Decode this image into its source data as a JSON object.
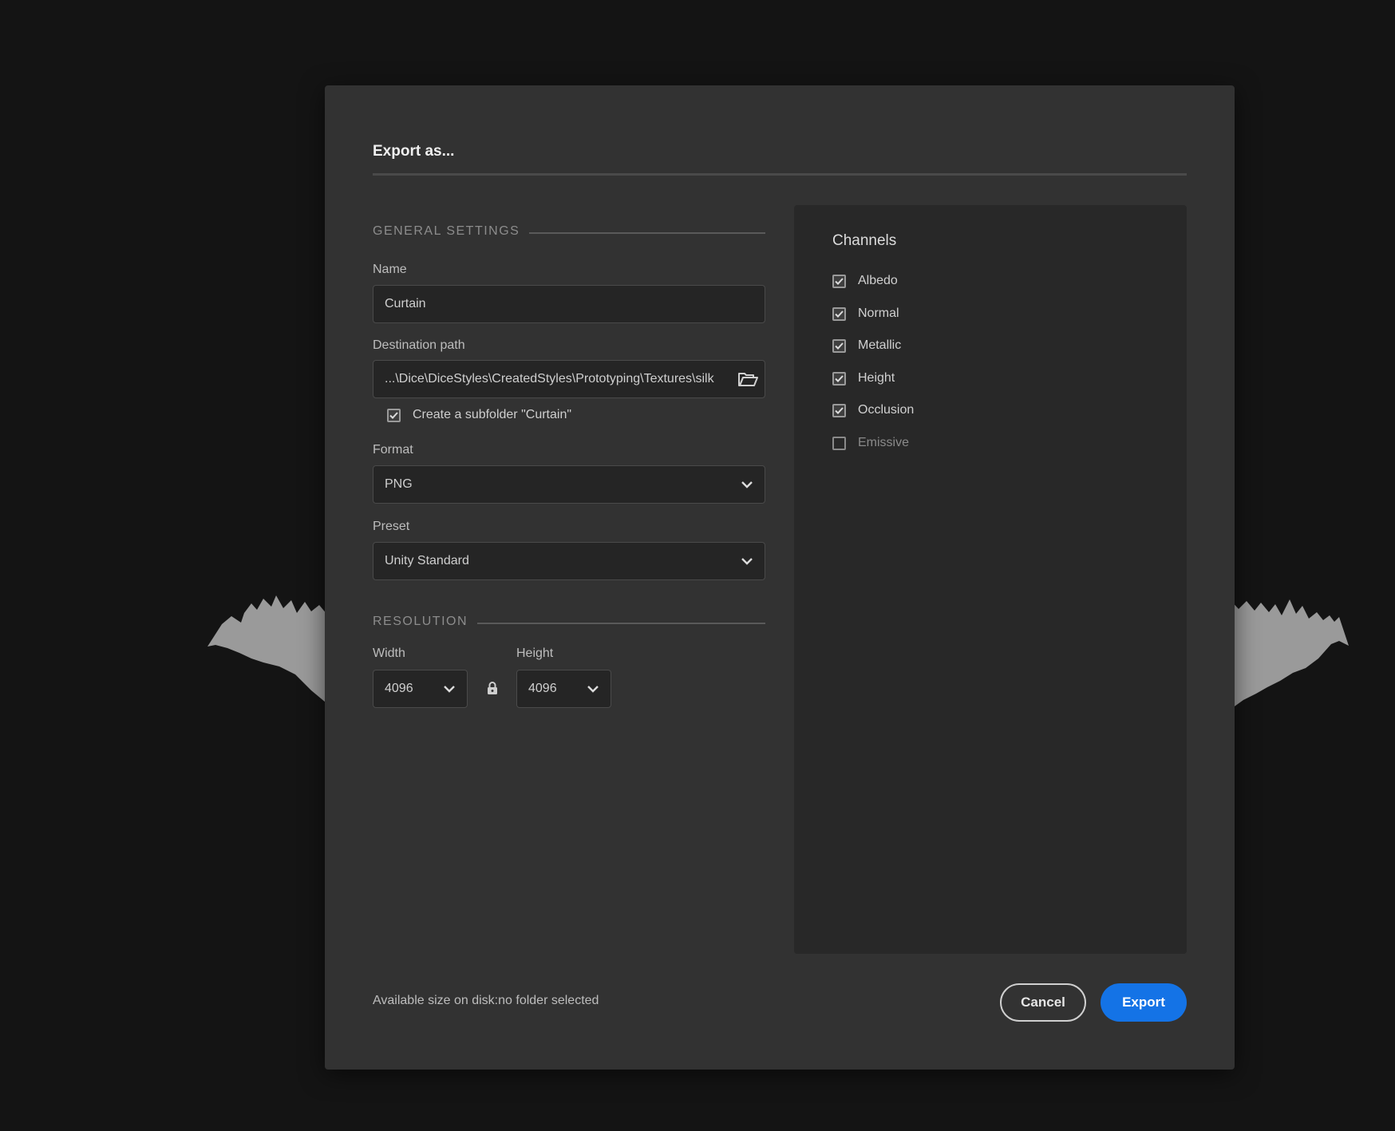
{
  "dialog": {
    "title": "Export as...",
    "general_settings": {
      "header": "GENERAL SETTINGS",
      "name": {
        "label": "Name",
        "value": "Curtain"
      },
      "destination_path": {
        "label": "Destination path",
        "value": "...\\Dice\\DiceStyles\\CreatedStyles\\Prototyping\\Textures\\silk",
        "browse_icon": "folder-open-icon"
      },
      "create_subfolder": {
        "label": "Create a subfolder \"Curtain\"",
        "checked": true
      },
      "format": {
        "label": "Format",
        "value": "PNG"
      },
      "preset": {
        "label": "Preset",
        "value": "Unity Standard"
      }
    },
    "resolution": {
      "header": "RESOLUTION",
      "width": {
        "label": "Width",
        "value": "4096"
      },
      "height": {
        "label": "Height",
        "value": "4096"
      },
      "lock_icon": "lock-icon"
    },
    "channels": {
      "title": "Channels",
      "items": [
        {
          "label": "Albedo",
          "checked": true
        },
        {
          "label": "Normal",
          "checked": true
        },
        {
          "label": "Metallic",
          "checked": true
        },
        {
          "label": "Height",
          "checked": true
        },
        {
          "label": "Occlusion",
          "checked": true
        },
        {
          "label": "Emissive",
          "checked": false
        }
      ]
    },
    "footer": {
      "available_size": "Available size on disk:no folder selected",
      "cancel_label": "Cancel",
      "export_label": "Export"
    }
  },
  "colors": {
    "accent": "#1473e6",
    "dialog_bg": "#323232",
    "panel_bg": "#282828",
    "backdrop": "#141414"
  }
}
